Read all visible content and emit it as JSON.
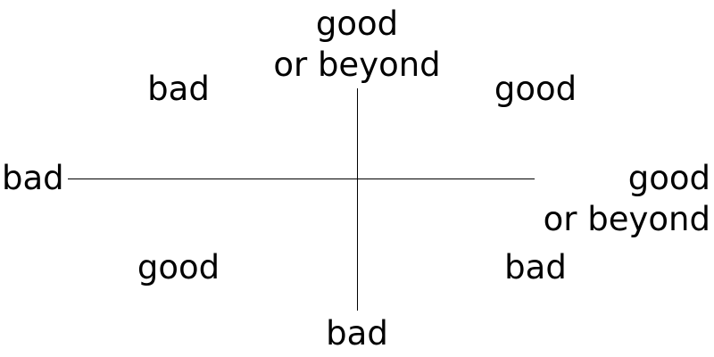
{
  "labels": {
    "top": {
      "line1": "good",
      "line2": "or beyond"
    },
    "bottom": "bad",
    "left": "bad",
    "right": {
      "line1": "good",
      "line2": "or beyond"
    },
    "top_left": "bad",
    "top_right": "good",
    "bottom_left": "good",
    "bottom_right": "bad"
  },
  "colors": {
    "text": "#000000",
    "axis": "#000000",
    "background": "#ffffff"
  }
}
